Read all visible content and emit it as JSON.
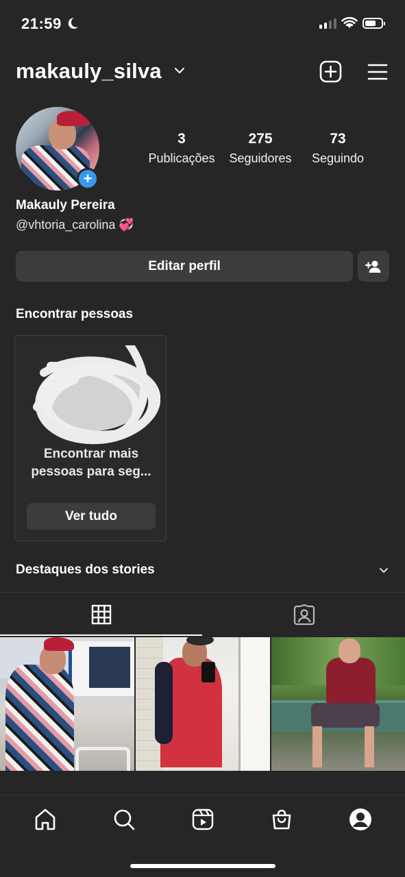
{
  "status_bar": {
    "time": "21:59",
    "battery_level": 0.7
  },
  "header": {
    "username": "makauly_silva"
  },
  "profile": {
    "stats": [
      {
        "value": "3",
        "label": "Publicações"
      },
      {
        "value": "275",
        "label": "Seguidores"
      },
      {
        "value": "73",
        "label": "Seguindo"
      }
    ],
    "full_name": "Makauly Pereira",
    "bio_handle": "@vhtoria_carolina 💞",
    "edit_profile_label": "Editar perfil"
  },
  "find_people": {
    "title": "Encontrar pessoas",
    "card_text": "Encontrar mais pessoas para seg...",
    "card_text_line1": "Encontrar mais",
    "card_text_line2": "pessoas para seg...",
    "see_all_label": "Ver tudo"
  },
  "highlights": {
    "title": "Destaques dos stories"
  },
  "tabs": [
    {
      "icon": "grid-icon",
      "active": true
    },
    {
      "icon": "tagged-person-icon",
      "active": false
    }
  ],
  "posts": [
    {
      "icon": "photo"
    },
    {
      "icon": "photo"
    },
    {
      "icon": "photo"
    }
  ],
  "bottom_nav": [
    {
      "icon": "home-icon"
    },
    {
      "icon": "search-icon"
    },
    {
      "icon": "reels-icon"
    },
    {
      "icon": "shop-icon"
    },
    {
      "icon": "profile-icon"
    }
  ],
  "colors": {
    "background": "#262626",
    "button": "#3c3c3c",
    "accent_blue": "#3897f0"
  }
}
